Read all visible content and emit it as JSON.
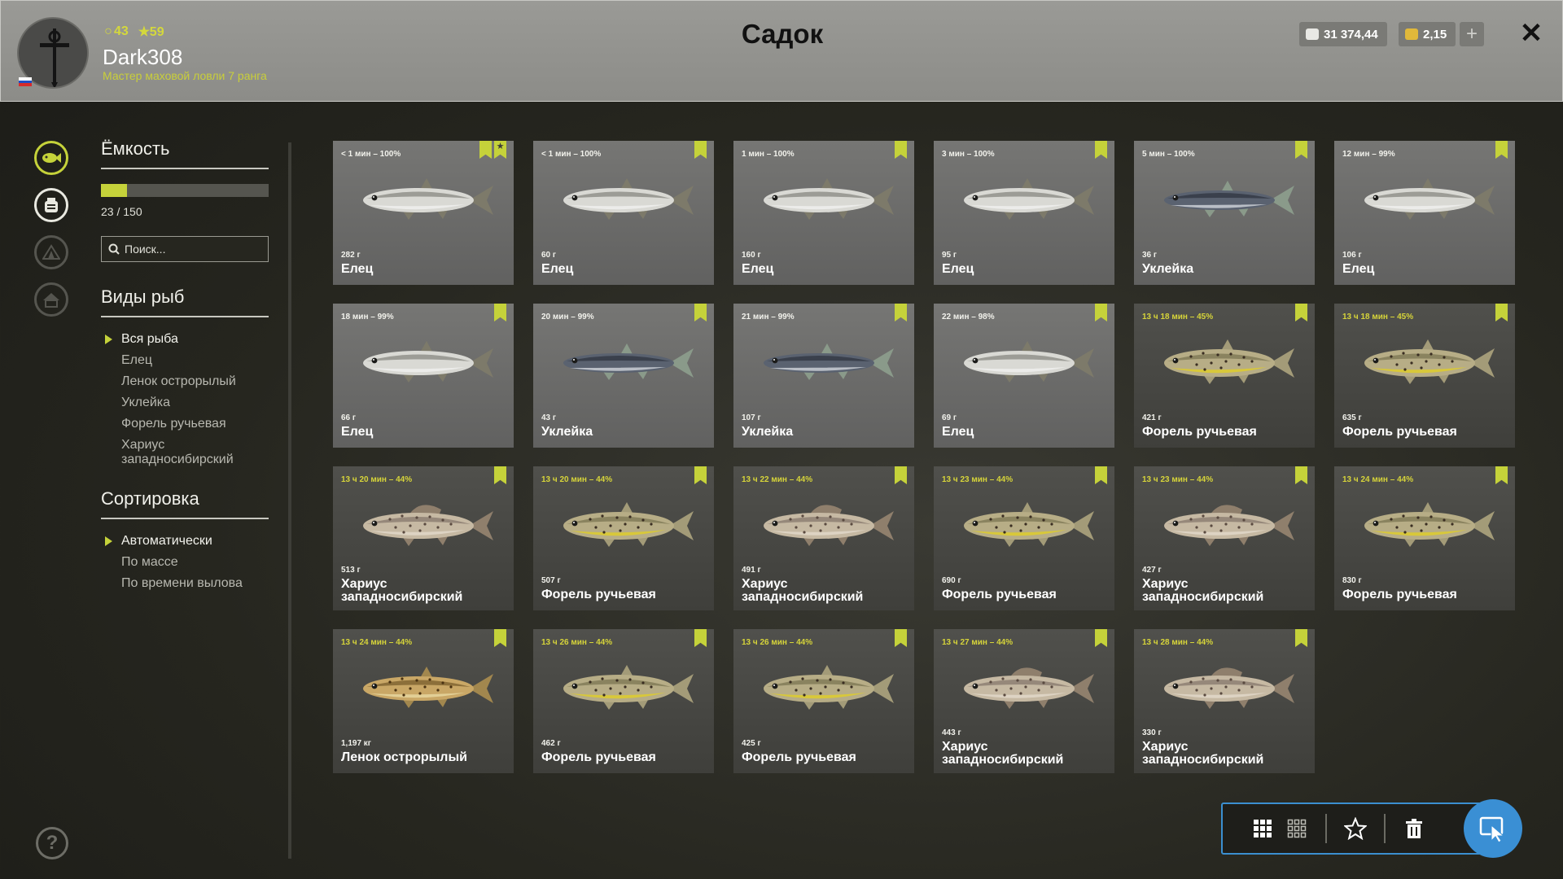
{
  "header": {
    "title": "Садок",
    "username": "Dark308",
    "rank_text": "Мастер маховой ловли 7 ранга",
    "stat_level": "43",
    "stat_stars": "59",
    "silver": "31 374,44",
    "gold": "2,15",
    "plus": "+",
    "close": "✕",
    "flag_colors": [
      "#ffffff",
      "#1f4fc8",
      "#d62b2b"
    ]
  },
  "rail": {
    "items": [
      {
        "name": "fish-keepnet-icon",
        "active": true
      },
      {
        "name": "bucket-icon",
        "active": false
      },
      {
        "name": "tent-icon",
        "active": false
      },
      {
        "name": "home-icon",
        "active": false
      }
    ],
    "help": "?"
  },
  "capacity": {
    "heading": "Ёмкость",
    "count_text": "23 / 150",
    "used": 23,
    "max": 150
  },
  "search": {
    "placeholder": "Поиск..."
  },
  "species": {
    "heading": "Виды рыб",
    "items": [
      "Вся рыба",
      "Елец",
      "Ленок острорылый",
      "Уклейка",
      "Форель ручьевая",
      "Хариус западносибирский"
    ],
    "selected": 0
  },
  "sorting": {
    "heading": "Сортировка",
    "items": [
      "Автоматически",
      "По массе",
      "По времени вылова"
    ],
    "selected": 0
  },
  "fish_cards": [
    {
      "time": "< 1 мин – 100%",
      "weight": "282 г",
      "name": "Елец",
      "type": "dace",
      "star": true
    },
    {
      "time": "< 1 мин – 100%",
      "weight": "60 г",
      "name": "Елец",
      "type": "dace",
      "star": false
    },
    {
      "time": "1 мин – 100%",
      "weight": "160 г",
      "name": "Елец",
      "type": "dace",
      "star": false
    },
    {
      "time": "3 мин – 100%",
      "weight": "95 г",
      "name": "Елец",
      "type": "dace",
      "star": false
    },
    {
      "time": "5 мин – 100%",
      "weight": "36 г",
      "name": "Уклейка",
      "type": "bleak",
      "star": false
    },
    {
      "time": "12 мин – 99%",
      "weight": "106 г",
      "name": "Елец",
      "type": "dace",
      "star": false
    },
    {
      "time": "18 мин – 99%",
      "weight": "66 г",
      "name": "Елец",
      "type": "dace",
      "star": false
    },
    {
      "time": "20 мин – 99%",
      "weight": "43 г",
      "name": "Уклейка",
      "type": "bleak",
      "star": false
    },
    {
      "time": "21 мин – 99%",
      "weight": "107 г",
      "name": "Уклейка",
      "type": "bleak",
      "star": false
    },
    {
      "time": "22 мин – 98%",
      "weight": "69 г",
      "name": "Елец",
      "type": "dace",
      "star": false
    },
    {
      "time": "13 ч 18 мин – 45%",
      "weight": "421 г",
      "name": "Форель ручьевая",
      "type": "trout",
      "star": false
    },
    {
      "time": "13 ч 18 мин – 45%",
      "weight": "635 г",
      "name": "Форель ручьевая",
      "type": "trout",
      "star": false
    },
    {
      "time": "13 ч 20 мин – 44%",
      "weight": "513 г",
      "name": "Хариус западносибирский",
      "type": "grayling",
      "star": false
    },
    {
      "time": "13 ч 20 мин – 44%",
      "weight": "507 г",
      "name": "Форель ручьевая",
      "type": "trout",
      "star": false
    },
    {
      "time": "13 ч 22 мин – 44%",
      "weight": "491 г",
      "name": "Хариус западносибирский",
      "type": "grayling",
      "star": false
    },
    {
      "time": "13 ч 23 мин – 44%",
      "weight": "690 г",
      "name": "Форель ручьевая",
      "type": "trout",
      "star": false
    },
    {
      "time": "13 ч 23 мин – 44%",
      "weight": "427 г",
      "name": "Хариус западносибирский",
      "type": "grayling",
      "star": false
    },
    {
      "time": "13 ч 24 мин – 44%",
      "weight": "830 г",
      "name": "Форель ручьевая",
      "type": "trout",
      "star": false
    },
    {
      "time": "13 ч 24 мин – 44%",
      "weight": "1,197 кг",
      "name": "Ленок острорылый",
      "type": "lenok",
      "star": false
    },
    {
      "time": "13 ч 26 мин – 44%",
      "weight": "462 г",
      "name": "Форель ручьевая",
      "type": "trout",
      "star": false
    },
    {
      "time": "13 ч 26 мин – 44%",
      "weight": "425 г",
      "name": "Форель ручьевая",
      "type": "trout",
      "star": false
    },
    {
      "time": "13 ч 27 мин – 44%",
      "weight": "443 г",
      "name": "Хариус западносибирский",
      "type": "grayling",
      "star": false
    },
    {
      "time": "13 ч 28 мин – 44%",
      "weight": "330 г",
      "name": "Хариус западносибирский",
      "type": "grayling",
      "star": false
    }
  ],
  "toolbar": {
    "buttons": [
      "grid-large-icon",
      "grid-small-icon",
      "star-icon",
      "trash-icon"
    ],
    "action": "select-cursor-icon"
  },
  "colors": {
    "accent": "#c5d23a",
    "fab": "#3a8fd4",
    "fresh_card": "#6c6c6a",
    "old_card": "#484844"
  }
}
